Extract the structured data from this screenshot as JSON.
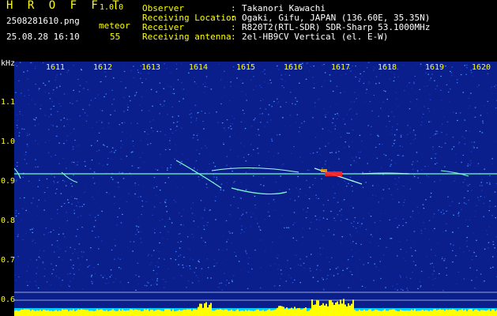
{
  "header": {
    "app_title": "H R O F F T",
    "app_version": "1.0.0",
    "file_name": "2508281610.png",
    "date_time": "25.08.28 16:10",
    "meteor_label": "meteor",
    "meteor_count": "55"
  },
  "info": [
    {
      "label": "Observer",
      "colon": ":",
      "value": "Takanori Kawachi"
    },
    {
      "label": "Receiving Location",
      "colon": ":",
      "value": "Ogaki, Gifu, JAPAN (136.60E, 35.35N)"
    },
    {
      "label": "Receiver",
      "colon": ":",
      "value": "R820T2(RTL-SDR) SDR-Sharp 53.1000MHz"
    },
    {
      "label": "Receiving antenna",
      "colon": ":",
      "value": "2el-HB9CV Vertical (el. E-W)"
    }
  ],
  "axis": {
    "y_unit": "kHz",
    "x_ticks": [
      "1611",
      "1612",
      "1613",
      "1614",
      "1615",
      "1616",
      "1617",
      "1618",
      "1619",
      "1620"
    ],
    "y_ticks": [
      "1.1",
      "1.0",
      "0.9",
      "0.8",
      "0.7",
      "0.6"
    ]
  },
  "colors": {
    "background": "#0a1f8c",
    "text_yellow": "#ffff00",
    "carrier": "#66ffcc",
    "hot": "#ff2020",
    "baseline_cyan": "#00ccff",
    "baseline_yellow": "#ffff00"
  }
}
